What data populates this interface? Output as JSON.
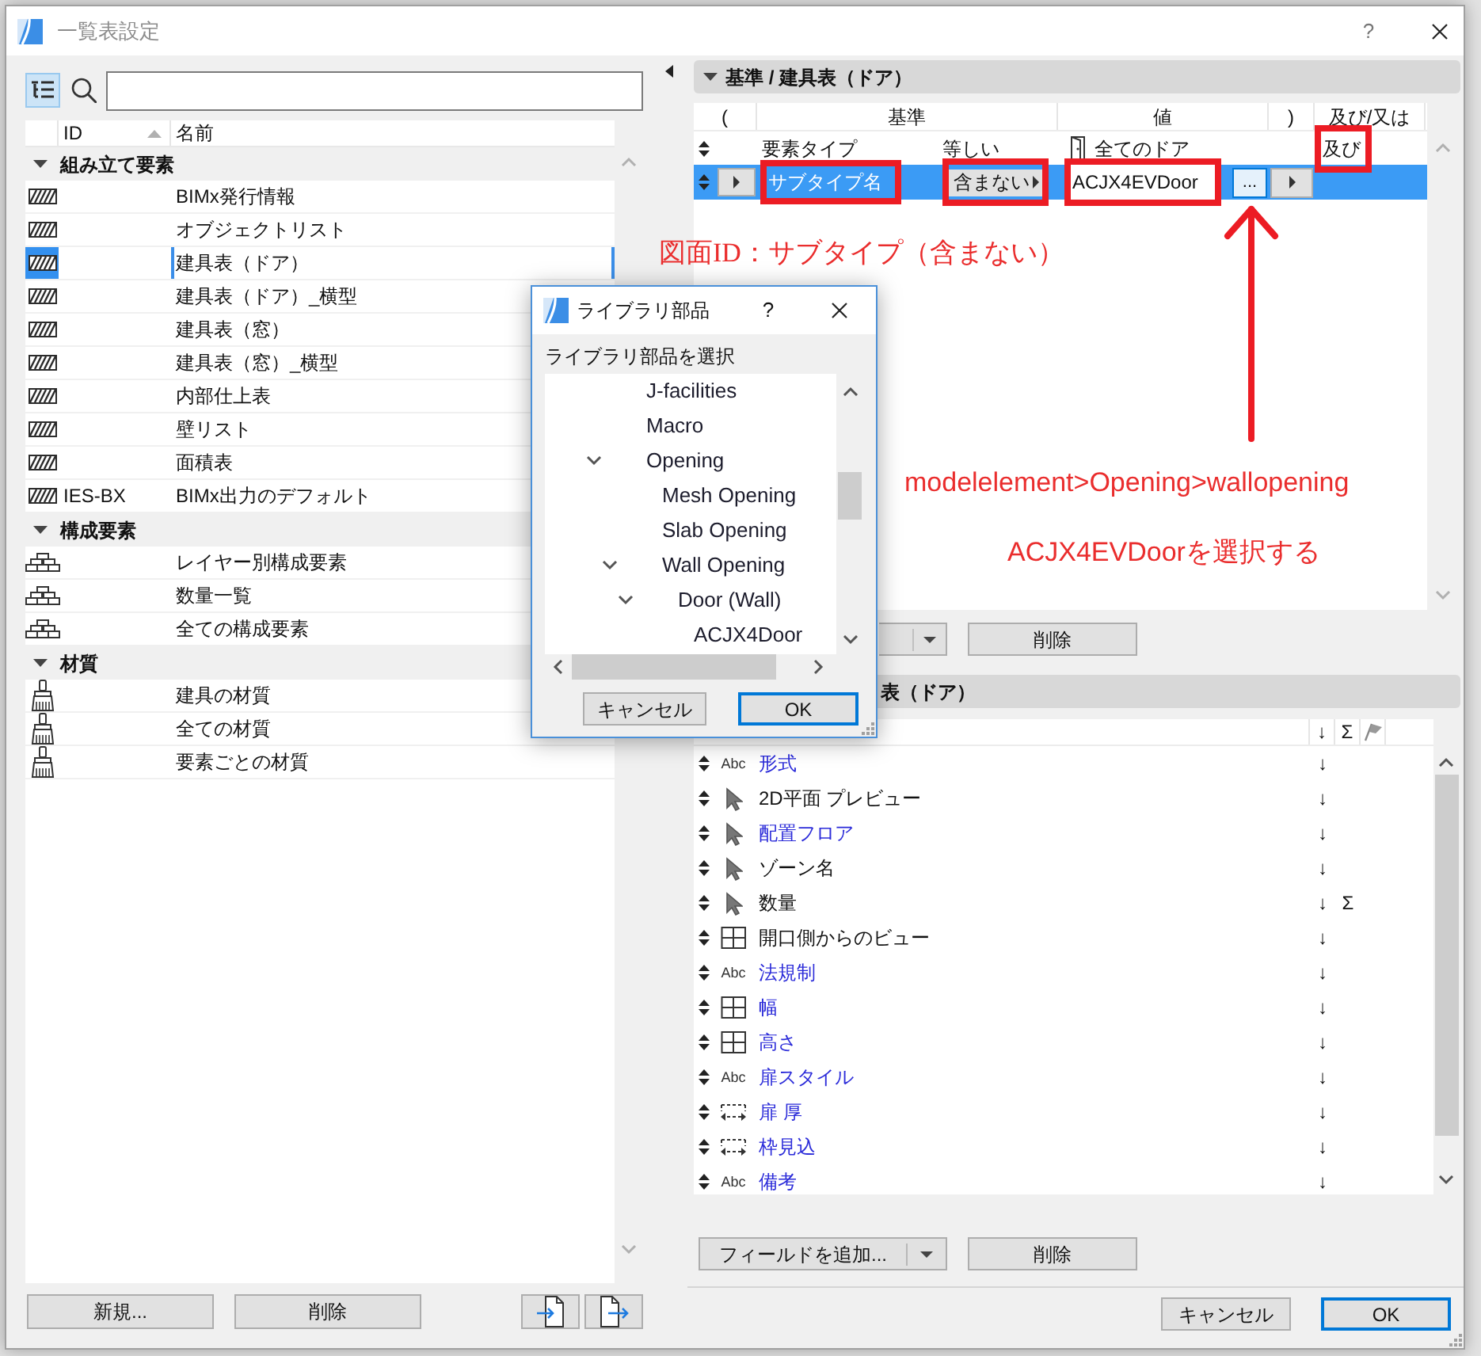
{
  "window": {
    "title": "一覧表設定",
    "help": "?"
  },
  "left_panel": {
    "view_toggle": {
      "selected": true
    },
    "columns": [
      {
        "label": "ID",
        "sorted": true
      },
      {
        "label": "名前",
        "sorted": false
      }
    ],
    "groups": [
      {
        "label": "組み立て要素",
        "expanded": true,
        "kind": "element",
        "items": [
          {
            "name": "BIMx発行情報",
            "selected": false
          },
          {
            "name": "オブジェクトリスト",
            "selected": false
          },
          {
            "name": "建具表（ドア）",
            "selected": true
          },
          {
            "name": "建具表（ドア）_横型",
            "selected": false
          },
          {
            "name": "建具表（窓）",
            "selected": false
          },
          {
            "name": "建具表（窓）_横型",
            "selected": false
          },
          {
            "name": "内部仕上表",
            "selected": false
          },
          {
            "name": "壁リスト",
            "selected": false
          },
          {
            "name": "面積表",
            "selected": false
          },
          {
            "id": "IES-BX",
            "name": "BIMx出力のデフォルト",
            "selected": false
          }
        ]
      },
      {
        "label": "構成要素",
        "expanded": true,
        "kind": "component",
        "items": [
          {
            "name": "レイヤー別構成要素",
            "selected": false
          },
          {
            "name": "数量一覧",
            "selected": false
          },
          {
            "name": "全ての構成要素",
            "selected": false
          }
        ]
      },
      {
        "label": "材質",
        "expanded": true,
        "kind": "material",
        "items": [
          {
            "name": "建具の材質",
            "selected": false
          },
          {
            "name": "全ての材質",
            "selected": false
          },
          {
            "name": "要素ごとの材質",
            "selected": false
          }
        ]
      }
    ],
    "buttons": [
      "新規...",
      "削除"
    ]
  },
  "criteria": {
    "title": "基準 / 建具表（ドア）",
    "expanded": true,
    "columns": [
      "(",
      "基準",
      "値",
      ")",
      "及び/又は"
    ],
    "rows": [
      {
        "selected": false,
        "field": {
          "text": "要素タイプ",
          "highlighted": false
        },
        "operator": {
          "text": "等しい",
          "highlighted": false
        },
        "value": {
          "text": "全てのドア",
          "kind": "door",
          "highlighted": false
        },
        "conjunction": {
          "text": "及び",
          "highlighted": true
        }
      },
      {
        "selected": true,
        "field": {
          "text": "サブタイプ名",
          "highlighted": true
        },
        "operator": {
          "text": "含まない",
          "highlighted": true
        },
        "value": {
          "text": "ACJX4EVDoor",
          "kind": "text",
          "highlighted": true
        },
        "browse": "..."
      }
    ],
    "buttons": [
      "削除"
    ]
  },
  "annotations": [
    {
      "text": "図面ID：サブタイプ（含まない）"
    },
    {
      "text": "modelelement>Opening>wallopening"
    },
    {
      "text": "ACJX4EVDoorを選択する"
    }
  ],
  "fields": {
    "title": "表（ドア）",
    "header": {
      "sort": "↓",
      "sum": "Σ"
    },
    "rows": [
      {
        "kind": "text",
        "type_label": "Abc",
        "name": "形式",
        "color": "#2b2bd9",
        "sort": "↓"
      },
      {
        "kind": "element",
        "name": "2D平面 プレビュー",
        "color": "#111111",
        "sort": "↓"
      },
      {
        "kind": "element",
        "name": "配置フロア",
        "color": "#2b2bd9",
        "sort": "↓"
      },
      {
        "kind": "element",
        "name": "ゾーン名",
        "color": "#111111",
        "sort": "↓"
      },
      {
        "kind": "element",
        "name": "数量",
        "color": "#111111",
        "sort": "↓",
        "sum": "Σ"
      },
      {
        "kind": "window",
        "name": "開口側からのビュー",
        "color": "#111111",
        "sort": "↓"
      },
      {
        "kind": "text",
        "type_label": "Abc",
        "name": "法規制",
        "color": "#2b2bd9",
        "sort": "↓"
      },
      {
        "kind": "window",
        "name": "幅",
        "color": "#2b2bd9",
        "sort": "↓"
      },
      {
        "kind": "window",
        "name": "高さ",
        "color": "#2b2bd9",
        "sort": "↓"
      },
      {
        "kind": "text",
        "type_label": "Abc",
        "name": "扉スタイル",
        "color": "#2b2bd9",
        "sort": "↓"
      },
      {
        "kind": "dimension",
        "name": "扉 厚",
        "color": "#2b2bd9",
        "sort": "↓"
      },
      {
        "kind": "dimension",
        "name": "枠見込",
        "color": "#2b2bd9",
        "sort": "↓"
      },
      {
        "kind": "text",
        "type_label": "Abc",
        "name": "備考",
        "color": "#2b2bd9",
        "sort": "↓"
      }
    ],
    "buttons": [
      {
        "label": "フィールドを追加...",
        "kind": "split"
      },
      {
        "label": "削除",
        "kind": "plain"
      }
    ]
  },
  "footer_buttons": [
    {
      "label": "キャンセル",
      "default": false
    },
    {
      "label": "OK",
      "default": true
    }
  ],
  "library_dialog": {
    "title": "ライブラリ部品",
    "help": "?",
    "prompt": "ライブラリ部品を選択",
    "tree": [
      {
        "label": "J-facilities",
        "expanded": false
      },
      {
        "label": "Macro",
        "expanded": false
      },
      {
        "label": "Opening",
        "expanded": true,
        "children": [
          {
            "label": "Mesh Opening",
            "expanded": false
          },
          {
            "label": "Slab Opening",
            "expanded": false
          },
          {
            "label": "Wall Opening",
            "expanded": true,
            "children": [
              {
                "label": "Door (Wall)",
                "expanded": true,
                "children": [
                  {
                    "label": "ACJX4Door",
                    "expanded": false
                  }
                ]
              }
            ]
          }
        ]
      }
    ],
    "buttons": [
      {
        "label": "キャンセル",
        "default": false
      },
      {
        "label": "OK",
        "default": true
      }
    ]
  }
}
